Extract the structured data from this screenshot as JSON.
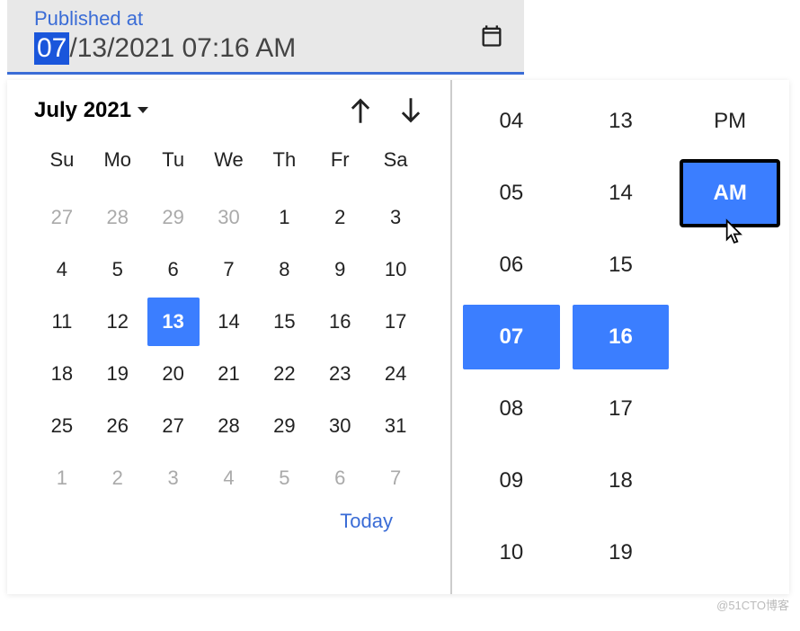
{
  "input": {
    "label": "Published at",
    "selected_segment": "07",
    "rest_value": "/13/2021 07:16 AM"
  },
  "calendar": {
    "month_label": "July 2021",
    "dow": [
      "Su",
      "Mo",
      "Tu",
      "We",
      "Th",
      "Fr",
      "Sa"
    ],
    "weeks": [
      [
        {
          "n": "27",
          "muted": true
        },
        {
          "n": "28",
          "muted": true
        },
        {
          "n": "29",
          "muted": true
        },
        {
          "n": "30",
          "muted": true
        },
        {
          "n": "1"
        },
        {
          "n": "2"
        },
        {
          "n": "3"
        }
      ],
      [
        {
          "n": "4"
        },
        {
          "n": "5"
        },
        {
          "n": "6"
        },
        {
          "n": "7"
        },
        {
          "n": "8"
        },
        {
          "n": "9"
        },
        {
          "n": "10"
        }
      ],
      [
        {
          "n": "11"
        },
        {
          "n": "12"
        },
        {
          "n": "13",
          "selected": true
        },
        {
          "n": "14"
        },
        {
          "n": "15"
        },
        {
          "n": "16"
        },
        {
          "n": "17"
        }
      ],
      [
        {
          "n": "18"
        },
        {
          "n": "19"
        },
        {
          "n": "20"
        },
        {
          "n": "21"
        },
        {
          "n": "22"
        },
        {
          "n": "23"
        },
        {
          "n": "24"
        }
      ],
      [
        {
          "n": "25"
        },
        {
          "n": "26"
        },
        {
          "n": "27"
        },
        {
          "n": "28"
        },
        {
          "n": "29"
        },
        {
          "n": "30"
        },
        {
          "n": "31"
        }
      ],
      [
        {
          "n": "1",
          "muted": true
        },
        {
          "n": "2",
          "muted": true
        },
        {
          "n": "3",
          "muted": true
        },
        {
          "n": "4",
          "muted": true
        },
        {
          "n": "5",
          "muted": true
        },
        {
          "n": "6",
          "muted": true
        },
        {
          "n": "7",
          "muted": true
        }
      ]
    ],
    "today_label": "Today"
  },
  "time": {
    "hours": [
      "04",
      "05",
      "06",
      "07",
      "08",
      "09",
      "10"
    ],
    "minutes": [
      "13",
      "14",
      "15",
      "16",
      "17",
      "18",
      "19"
    ],
    "ampm": [
      "PM",
      "AM"
    ],
    "selected_hour": "07",
    "selected_minute": "16",
    "selected_ampm": "AM"
  },
  "watermark": "@51CTO博客"
}
